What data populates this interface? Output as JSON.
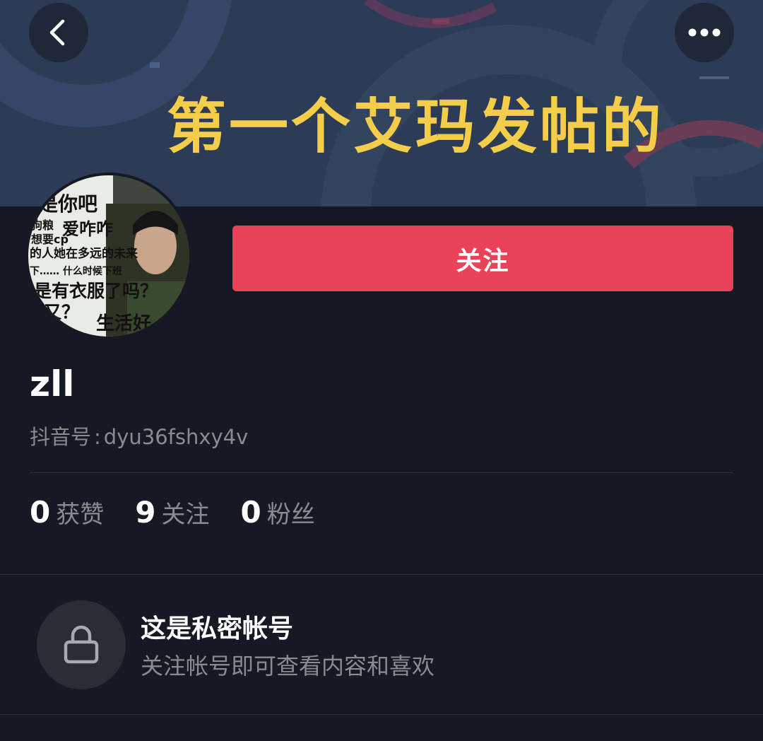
{
  "banner": {
    "title": "第一个艾玛发帖的",
    "colors": {
      "background": "#2b3a55",
      "title": "#f4cd4b",
      "accent_shapes": "#7a3d5a"
    }
  },
  "header": {
    "back_icon": "chevron-left-icon",
    "more_icon": "more-horizontal-icon"
  },
  "profile": {
    "avatar_text_lines": [
      "是你吧",
      "狗粮",
      "爱咋咋",
      "想要cp",
      "的人她在多远的未来",
      "下…… 什么时候下班",
      "是有衣服了吗？",
      "又？",
      "生活好"
    ],
    "follow_label": "关注",
    "follow_color": "#ea4359",
    "nickname": "zll",
    "id_label": "抖音号",
    "id_colon": ":",
    "id_value": "dyu36fshxy4v"
  },
  "stats": [
    {
      "value": "0",
      "label": "获赞"
    },
    {
      "value": "9",
      "label": "关注"
    },
    {
      "value": "0",
      "label": "粉丝"
    }
  ],
  "private": {
    "icon": "lock-icon",
    "title": "这是私密帐号",
    "subtitle": "关注帐号即可查看内容和喜欢"
  }
}
